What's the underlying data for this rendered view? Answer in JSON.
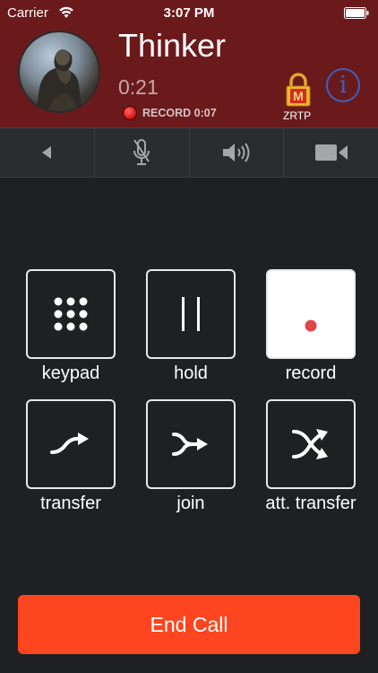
{
  "status_bar": {
    "carrier": "Carrier",
    "time": "3:07 PM"
  },
  "call": {
    "contact_name": "Thinker",
    "duration": "0:21",
    "record_status": "RECORD 0:07",
    "security_label": "ZRTP",
    "lock_letter": "M",
    "info_glyph": "i"
  },
  "controls": [
    {
      "icon": "back-arrow-icon"
    },
    {
      "icon": "microphone-mute-icon"
    },
    {
      "icon": "speaker-icon"
    },
    {
      "icon": "video-camera-icon"
    }
  ],
  "actions": [
    {
      "label": "keypad",
      "icon": "keypad-icon"
    },
    {
      "label": "hold",
      "icon": "pause-icon"
    },
    {
      "label": "record",
      "icon": "record-icon",
      "active": true
    },
    {
      "label": "transfer",
      "icon": "transfer-arrow-icon"
    },
    {
      "label": "join",
      "icon": "join-arrow-icon"
    },
    {
      "label": "att. transfer",
      "icon": "cross-arrows-icon"
    }
  ],
  "end_call_label": "End Call",
  "colors": {
    "header_bg": "#6b1a1c",
    "end_call": "#fd4620",
    "record_red": "#e0454a",
    "info_blue": "#3b62c4"
  }
}
